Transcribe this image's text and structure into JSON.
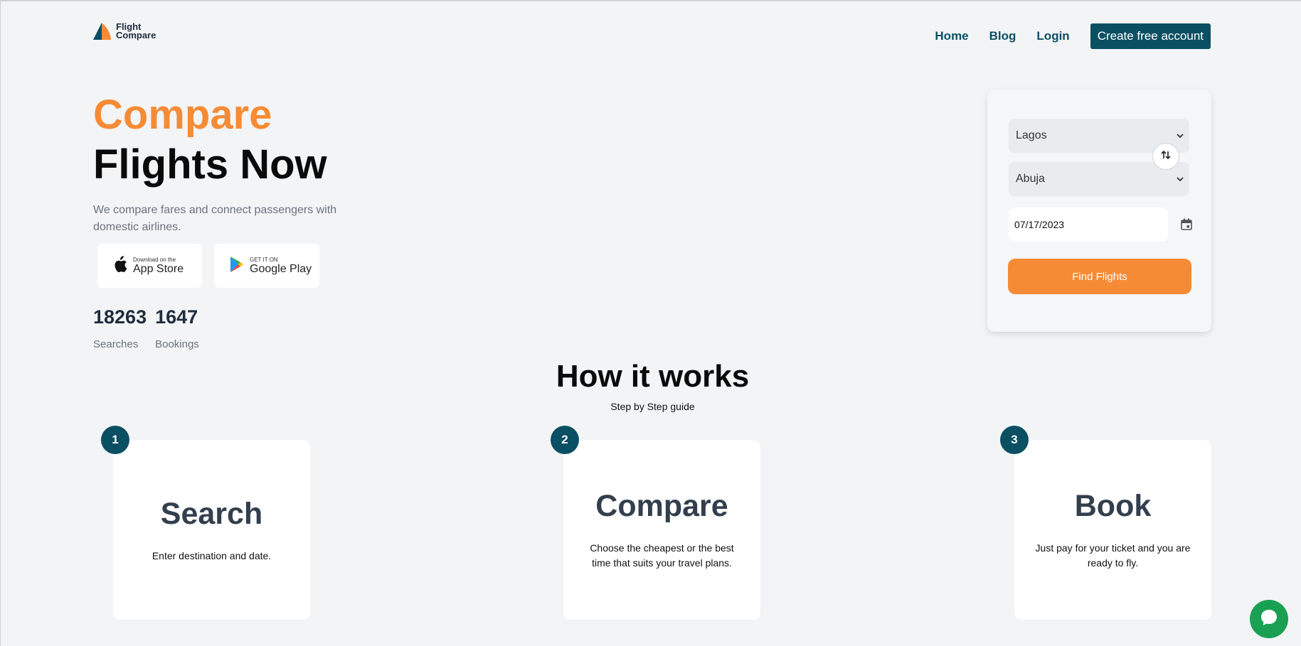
{
  "header": {
    "logo_line1": "Flight",
    "logo_line2": "Compare",
    "nav": [
      "Home",
      "Blog",
      "Login"
    ],
    "cta_label": "Create free account"
  },
  "hero": {
    "title_highlight": "Compare",
    "title_rest": "Flights Now",
    "description": "We compare fares and connect passengers with domestic airlines.",
    "app_store": {
      "small": "Download on the",
      "big": "App Store"
    },
    "google_play": {
      "small": "GET IT ON",
      "big": "Google Play"
    },
    "stats": [
      {
        "value": "18263",
        "label": "Searches"
      },
      {
        "value": "1647",
        "label": "Bookings"
      }
    ]
  },
  "search": {
    "from_value": "Lagos",
    "to_value": "Abuja",
    "date_value": "07/17/2023",
    "find_label": "Find Flights"
  },
  "how": {
    "title": "How it works",
    "subtitle": "Step by Step guide",
    "steps": [
      {
        "number": "1",
        "title": "Search",
        "text": "Enter destination and date."
      },
      {
        "number": "2",
        "title": "Compare",
        "text": "Choose the cheapest or the best time that suits your travel plans."
      },
      {
        "number": "3",
        "title": "Book",
        "text": "Just pay for your ticket and you are ready to fly."
      }
    ]
  },
  "colors": {
    "brand": "#0b4f63",
    "accent": "#f68b36",
    "chat": "#1aa053"
  }
}
